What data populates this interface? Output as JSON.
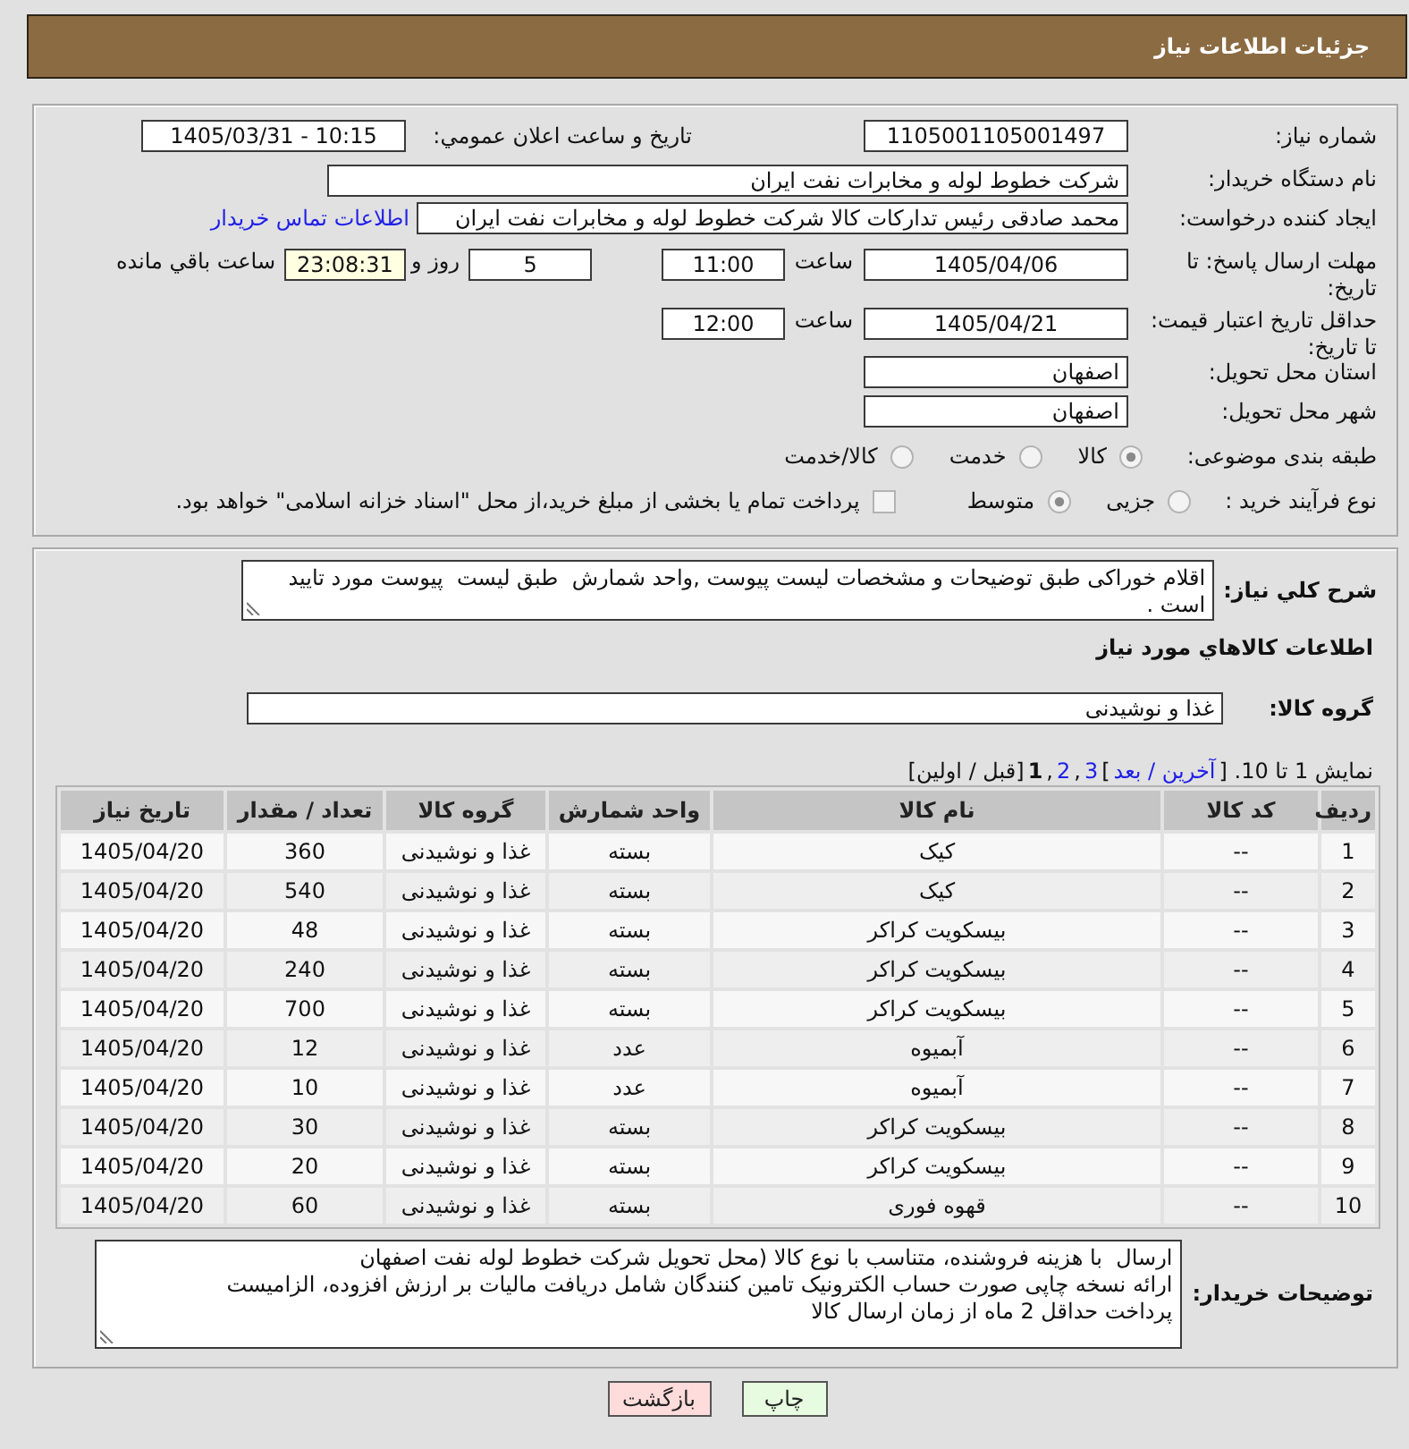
{
  "header": {
    "title": "جزئیات اطلاعات نیاز"
  },
  "form": {
    "need_number": {
      "label": "شماره نیاز:",
      "value": "1105001105001497"
    },
    "announce_datetime": {
      "label": "تاریخ و ساعت اعلان عمومي:",
      "value": "1405/03/31 - 10:15"
    },
    "buyer_org": {
      "label": "نام دستگاه خریدار:",
      "value": "شرکت خطوط لوله و مخابرات نفت ایران"
    },
    "requester": {
      "label": "ایجاد کننده درخواست:",
      "value": "محمد صادقی رئیس تدارکات کالا  شرکت خطوط لوله و مخابرات نفت ایران",
      "contact_link": "اطلاعات تماس خریدار"
    },
    "reply_deadline": {
      "label": "مهلت ارسال پاسخ: تا تاریخ:",
      "date": "1405/04/06",
      "time_label": "ساعت",
      "time": "11:00",
      "days": "5",
      "days_label": "روز و",
      "remaining": "23:08:31",
      "remaining_label": "ساعت باقي مانده"
    },
    "price_validity": {
      "label": "حداقل تاریخ اعتبار قیمت: تا تاریخ:",
      "date": "1405/04/21",
      "time_label": "ساعت",
      "time": "12:00"
    },
    "province": {
      "label": "استان محل تحویل:",
      "value": "اصفهان"
    },
    "city": {
      "label": "شهر محل تحویل:",
      "value": "اصفهان"
    },
    "category": {
      "label": "طبقه بندی موضوعی:",
      "options": [
        {
          "label": "کالا",
          "selected": true
        },
        {
          "label": "خدمت",
          "selected": false
        },
        {
          "label": "کالا/خدمت",
          "selected": false
        }
      ]
    },
    "purchase_type": {
      "label": "نوع فرآیند خرید :",
      "options": [
        {
          "label": "جزیی",
          "selected": false
        },
        {
          "label": "متوسط",
          "selected": true
        }
      ],
      "treasury_option": {
        "label": "پرداخت تمام یا بخشی از مبلغ خرید،از محل \"اسناد خزانه اسلامی\" خواهد بود.",
        "checked": false
      }
    }
  },
  "description": {
    "label": "شرح کلي نیاز:",
    "value": "اقلام خوراکی طبق توضیحات و مشخصات لیست پیوست ,واحد شمارش  طبق لیست  پیوست مورد تایید است ."
  },
  "goods": {
    "title": "اطلاعات کالاهاي مورد نیاز",
    "group": {
      "label": "گروه کالا:",
      "value": "غذا و نوشیدنی"
    },
    "pager": [
      {
        "kind": "text",
        "text": "نمایش 1 تا 10. ["
      },
      {
        "kind": "link",
        "text": "آخرین / بعد"
      },
      {
        "kind": "text",
        "text": "]"
      },
      {
        "kind": "page",
        "text": "3",
        "selected": false
      },
      {
        "kind": "text",
        "text": ","
      },
      {
        "kind": "page",
        "text": "2",
        "selected": false
      },
      {
        "kind": "text",
        "text": ","
      },
      {
        "kind": "page",
        "text": "1",
        "selected": true
      },
      {
        "kind": "text",
        "text": "[قبل / اولین]"
      }
    ],
    "table": {
      "columns": [
        "ردیف",
        "کد کالا",
        "نام کالا",
        "واحد شمارش",
        "گروه کالا",
        "تعداد / مقدار",
        "تاریخ نیاز"
      ],
      "rows": [
        [
          "1",
          "--",
          "کیک",
          "بسته",
          "غذا و نوشیدنی",
          "360",
          "1405/04/20"
        ],
        [
          "2",
          "--",
          "کیک",
          "بسته",
          "غذا و نوشیدنی",
          "540",
          "1405/04/20"
        ],
        [
          "3",
          "--",
          "بیسکویت کراکر",
          "بسته",
          "غذا و نوشیدنی",
          "48",
          "1405/04/20"
        ],
        [
          "4",
          "--",
          "بیسکویت کراکر",
          "بسته",
          "غذا و نوشیدنی",
          "240",
          "1405/04/20"
        ],
        [
          "5",
          "--",
          "بیسکویت کراکر",
          "بسته",
          "غذا و نوشیدنی",
          "700",
          "1405/04/20"
        ],
        [
          "6",
          "--",
          "آبمیوه",
          "عدد",
          "غذا و نوشیدنی",
          "12",
          "1405/04/20"
        ],
        [
          "7",
          "--",
          "آبمیوه",
          "عدد",
          "غذا و نوشیدنی",
          "10",
          "1405/04/20"
        ],
        [
          "8",
          "--",
          "بیسکویت کراکر",
          "بسته",
          "غذا و نوشیدنی",
          "30",
          "1405/04/20"
        ],
        [
          "9",
          "--",
          "بیسکویت کراکر",
          "بسته",
          "غذا و نوشیدنی",
          "20",
          "1405/04/20"
        ],
        [
          "10",
          "--",
          "قهوه فوری",
          "بسته",
          "غذا و نوشیدنی",
          "60",
          "1405/04/20"
        ]
      ]
    }
  },
  "buyer_notes": {
    "label": "توضیحات خریدار:",
    "value": "ارسال  با هزینه فروشنده، متناسب با نوع کالا (محل تحویل شرکت خطوط لوله نفت اصفهان\nارائه نسخه چاپی صورت حساب الکترونیک تامین کنندگان شامل دریافت مالیات بر ارزش افزوده، الزامیست\nپرداخت حداقل 2 ماه از زمان ارسال کالا"
  },
  "buttons": [
    {
      "kind": "print",
      "label": "چاپ"
    },
    {
      "kind": "back",
      "label": "بازگشت"
    }
  ]
}
